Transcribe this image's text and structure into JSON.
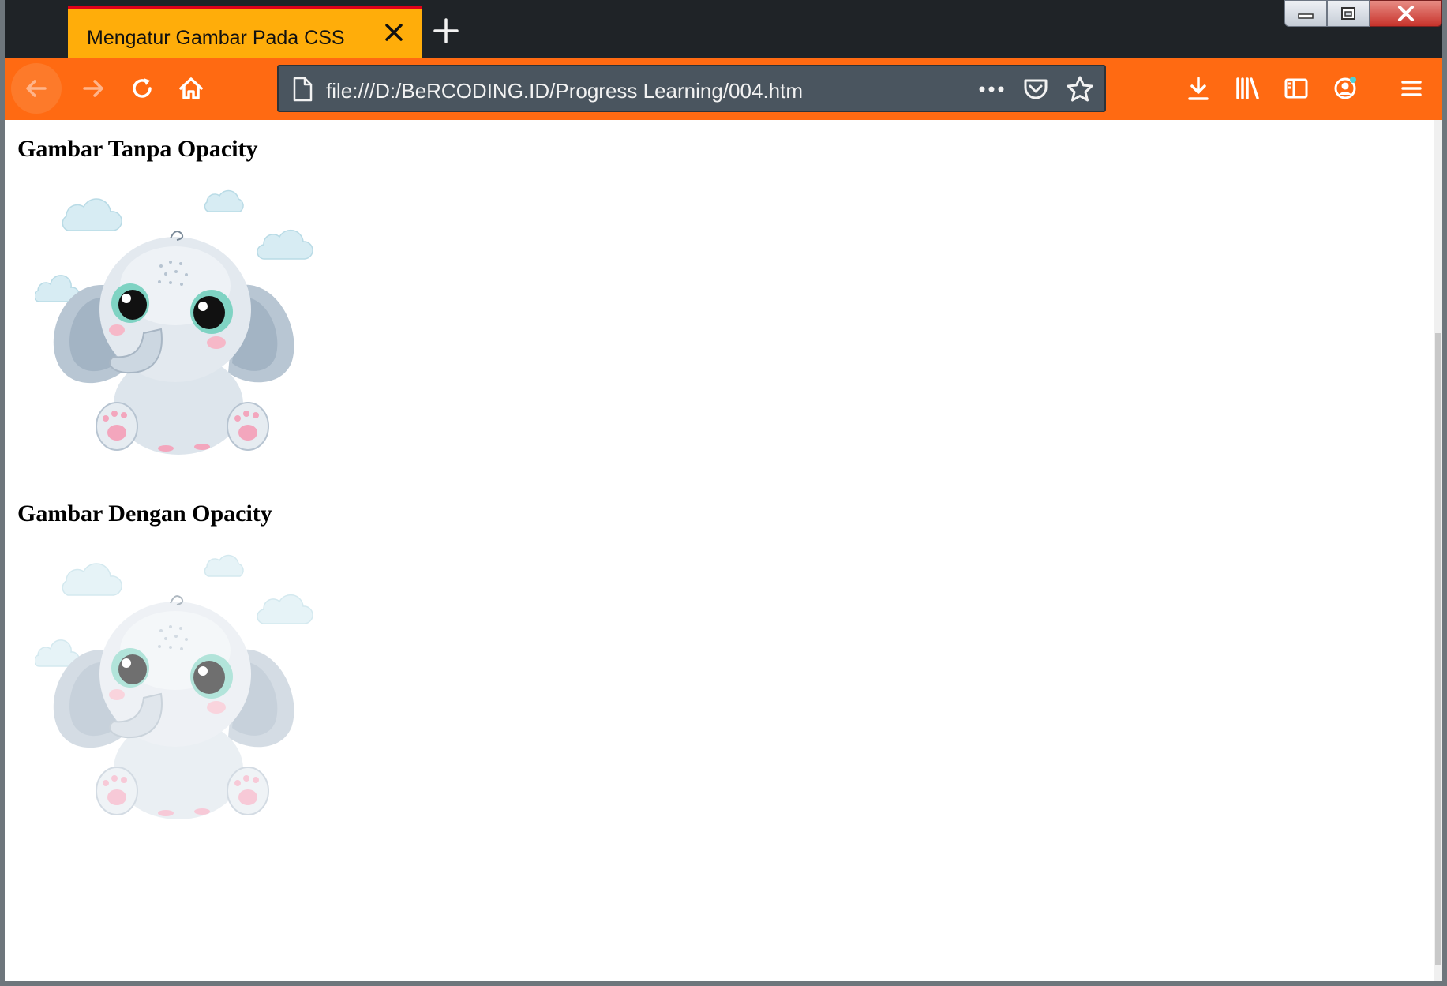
{
  "browser": {
    "tab_title": "Mengatur Gambar Pada CSS",
    "url": "file:///D:/BeRCODING.ID/Progress Learning/004.htm"
  },
  "toolbar_icons": [
    "back-icon",
    "forward-icon",
    "reload-icon",
    "home-icon",
    "page-icon",
    "more-icon",
    "pocket-icon",
    "bookmark-star-icon",
    "download-icon",
    "library-icon",
    "sidebar-icon",
    "account-icon",
    "menu-icon"
  ],
  "window_controls": [
    "minimize-icon",
    "maximize-icon",
    "close-icon"
  ],
  "colors": {
    "tab_active": "#ffad0a",
    "toolbar": "#ff6a12",
    "urlbar": "#4a555f",
    "titlebar": "#1f2327"
  },
  "page": {
    "section1": {
      "heading": "Gambar Tanpa Opacity"
    },
    "section2": {
      "heading": "Gambar Dengan Opacity",
      "image_opacity": 0.6
    }
  }
}
